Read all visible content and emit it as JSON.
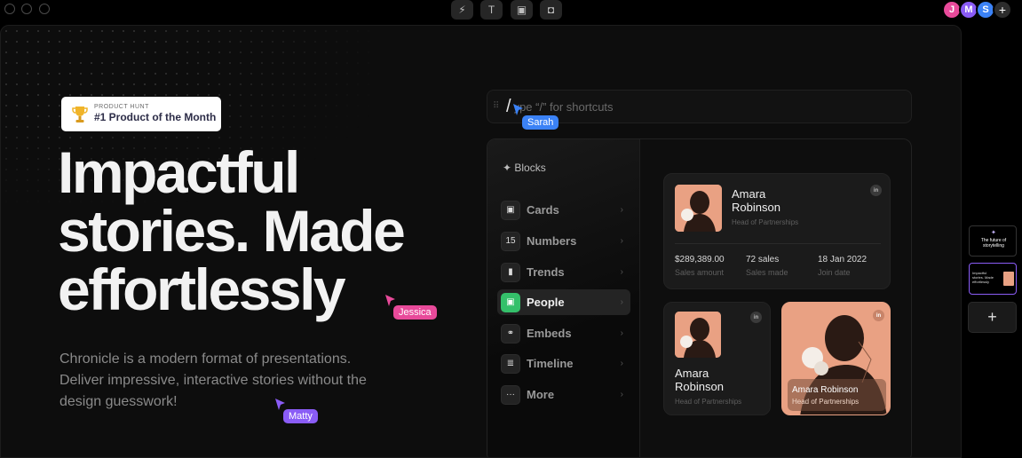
{
  "toolbar": {
    "tools": [
      {
        "icon": "bolt-icon",
        "glyph": "⚡"
      },
      {
        "icon": "text-icon",
        "glyph": "T"
      },
      {
        "icon": "image-icon",
        "glyph": "▣"
      },
      {
        "icon": "layout-icon",
        "glyph": "◘"
      }
    ],
    "avatars": [
      {
        "initial": "J",
        "color": "#e84a9a"
      },
      {
        "initial": "M",
        "color": "#8a5cf6"
      },
      {
        "initial": "S",
        "color": "#3b82f6"
      }
    ],
    "add_collaborator": "+"
  },
  "hero": {
    "badge_small": "PRODUCT HUNT",
    "badge_title": "#1 Product of the Month",
    "headline_lines": [
      "Impactful",
      "stories. Made",
      "effortlessly"
    ],
    "subtext": "Chronicle is a modern format of presentations. Deliver impressive, interactive stories without the design guesswork!"
  },
  "cursors": {
    "sarah": {
      "name": "Sarah",
      "color": "#3b82f6"
    },
    "jessica": {
      "name": "Jessica",
      "color": "#e84a9a"
    },
    "matty": {
      "name": "Matty",
      "color": "#8a5cf6"
    }
  },
  "shortcut": {
    "slash": "/",
    "placeholder": "Type “/” for shortcuts",
    "visible_text": "ype “/” for shortcuts"
  },
  "blocks": {
    "title": "✦ Blocks",
    "items": [
      {
        "label": "Cards",
        "icon": "image-icon",
        "glyph": "▣"
      },
      {
        "label": "Numbers",
        "icon": "numbers-icon",
        "glyph": "15"
      },
      {
        "label": "Trends",
        "icon": "bar-chart-icon",
        "glyph": "▮"
      },
      {
        "label": "People",
        "icon": "person-icon",
        "glyph": "▣",
        "active": true
      },
      {
        "label": "Embeds",
        "icon": "link-icon",
        "glyph": "⚭"
      },
      {
        "label": "Timeline",
        "icon": "timeline-icon",
        "glyph": "≣"
      },
      {
        "label": "More",
        "icon": "more-icon",
        "glyph": "···"
      }
    ],
    "chevron": "›"
  },
  "people": {
    "card_large": {
      "name_line1": "Amara",
      "name_line2": "Robinson",
      "role": "Head of Partnerships",
      "stats": [
        {
          "value": "$289,389.00",
          "label": "Sales amount"
        },
        {
          "value": "72 sales",
          "label": "Sales made"
        },
        {
          "value": "18 Jan 2022",
          "label": "Join date"
        }
      ]
    },
    "card_small": {
      "name_line1": "Amara",
      "name_line2": "Robinson",
      "role": "Head of Partnerships"
    },
    "card_photo": {
      "name": "Amara Robinson",
      "role": "Head of Partnerships"
    },
    "linkedin_label": "in"
  },
  "rail": {
    "thumb1_text": "The future of storytelling",
    "thumb2_text": "Impactful stories. Made effortlessly",
    "add_slide": "+"
  }
}
